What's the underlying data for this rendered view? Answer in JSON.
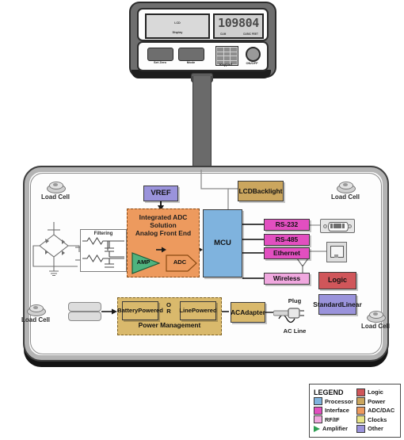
{
  "device": {
    "head": {
      "lcd_display_label": "LCD\nDisplay",
      "lcd_display_line1": "LCD",
      "lcd_display_line2": "Display",
      "segment_value": "109804",
      "segment_unit_left": "CUM",
      "segment_unit_right": "CUBIC FEET",
      "buttons": [
        {
          "name": "set-zero",
          "label": "Set Zero"
        },
        {
          "name": "mode",
          "label": "Mode"
        }
      ],
      "keypad_label": "Keypad",
      "power_label": "ON/OFF"
    },
    "load_cells": [
      {
        "position": "top-left",
        "label": "Load Cell"
      },
      {
        "position": "top-right",
        "label": "Load Cell"
      },
      {
        "position": "bottom-left",
        "label": "Load Cell"
      },
      {
        "position": "bottom-right",
        "label": "Load Cell"
      }
    ]
  },
  "blocks": {
    "filtering": "Filtering",
    "vref": "VREF",
    "adc_group_line1": "Integrated ADC",
    "adc_group_line2": "Solution",
    "adc_group_line3": "Analog Front End",
    "amp": "AMP",
    "adc": "ADC",
    "mcu": "MCU",
    "lcd_backlight_line1": "LCD",
    "lcd_backlight_line2": "Backlight",
    "rs232": "RS-232",
    "rs485": "RS-485",
    "ethernet": "Ethernet",
    "wireless": "Wireless",
    "logic": "Logic",
    "standard_linear_line1": "Standard",
    "standard_linear_line2": "Linear",
    "battery_powered_line1": "Battery",
    "battery_powered_line2": "Powered",
    "or_line1": "O",
    "or_line2": "R",
    "line_powered_line1": "Line",
    "line_powered_line2": "Powered",
    "power_management": "Power Management",
    "ac_adapter_line1": "AC",
    "ac_adapter_line2": "Adapter",
    "plug": "Plug",
    "ac_line": "AC Line"
  },
  "legend": {
    "title": "LEGEND",
    "items": [
      {
        "label": "Processor",
        "color": "#7FB3DE",
        "shape": "square"
      },
      {
        "label": "Logic",
        "color": "#D0565A",
        "shape": "square"
      },
      {
        "label": "Interface",
        "color": "#E24FC0",
        "shape": "square"
      },
      {
        "label": "Power",
        "color": "#CBA65E",
        "shape": "square"
      },
      {
        "label": "RF/IF",
        "color": "#F0A8DF",
        "shape": "square"
      },
      {
        "label": "ADC/DAC",
        "color": "#ED9A5E",
        "shape": "square"
      },
      {
        "label": "Clocks",
        "color": "#E8E386",
        "shape": "square"
      },
      {
        "label": "Amplifier",
        "color": "#2E9E52",
        "shape": "triangle"
      },
      {
        "label": "Other",
        "color": "#9A93DB",
        "shape": "square"
      }
    ]
  },
  "colors": {
    "processor": "#7FB3DE",
    "interface": "#E24FC0",
    "rf_if": "#F0A8DF",
    "amplifier": "#2E9E52",
    "logic": "#D0565A",
    "power": "#CBA65E",
    "adc_dac": "#ED9A5E",
    "clocks": "#E8E386",
    "other": "#9A93DB"
  }
}
